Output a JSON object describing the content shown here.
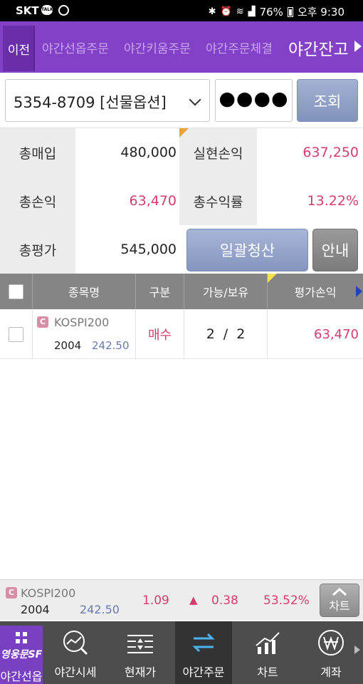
{
  "status_bar": {
    "carrier": "SKT",
    "talk_label": "TALK",
    "battery": "76%",
    "time": "오후 9:30"
  },
  "top_tabs": {
    "back_label": "이전",
    "tabs": [
      {
        "label": "야간선옵주문",
        "active": false
      },
      {
        "label": "야간키움주문",
        "active": false
      },
      {
        "label": "야간주문체결",
        "active": false
      },
      {
        "label": "야간잔고",
        "active": true
      }
    ]
  },
  "account": {
    "selected": "5354-8709 [선물옵션]",
    "password_mask": "●●●●",
    "query_label": "조회"
  },
  "summary": {
    "total_buy_label": "총매입",
    "total_buy_value": "480,000",
    "realized_pl_label": "실현손익",
    "realized_pl_value": "637,250",
    "total_pl_label": "총손익",
    "total_pl_value": "63,470",
    "total_return_label": "총수익률",
    "total_return_value": "13.22%",
    "total_eval_label": "총평가",
    "total_eval_value": "545,000",
    "liquidate_label": "일괄청산",
    "guide_label": "안내"
  },
  "table": {
    "headers": [
      "종목명",
      "구분",
      "가능/보유",
      "평가손익"
    ],
    "rows": [
      {
        "badge": "C",
        "symbol": "KOSPI200",
        "month": "2004",
        "strike": "242.50",
        "side": "매수",
        "available": "2",
        "held": "2",
        "pl": "63,470"
      }
    ]
  },
  "quote_bar": {
    "badge": "C",
    "symbol": "KOSPI200",
    "month": "2004",
    "strike": "242.50",
    "price": "1.09",
    "change_arrow": "▲",
    "change": "0.38",
    "rate": "53.52%",
    "chart_label": "차트"
  },
  "bottom_nav": {
    "brand": "영웅문SF",
    "items": [
      {
        "label": "야간선옵",
        "icon": "grid-icon"
      },
      {
        "label": "야간시세",
        "icon": "globe-search-icon"
      },
      {
        "label": "현재가",
        "icon": "price-lines-icon"
      },
      {
        "label": "야간주문",
        "icon": "exchange-arrows-icon"
      },
      {
        "label": "차트",
        "icon": "chart-icon"
      },
      {
        "label": "계좌",
        "icon": "won-icon"
      }
    ]
  },
  "colors": {
    "purple": "#8241c6",
    "pink": "#d63d6d",
    "header_gray": "#858585"
  }
}
